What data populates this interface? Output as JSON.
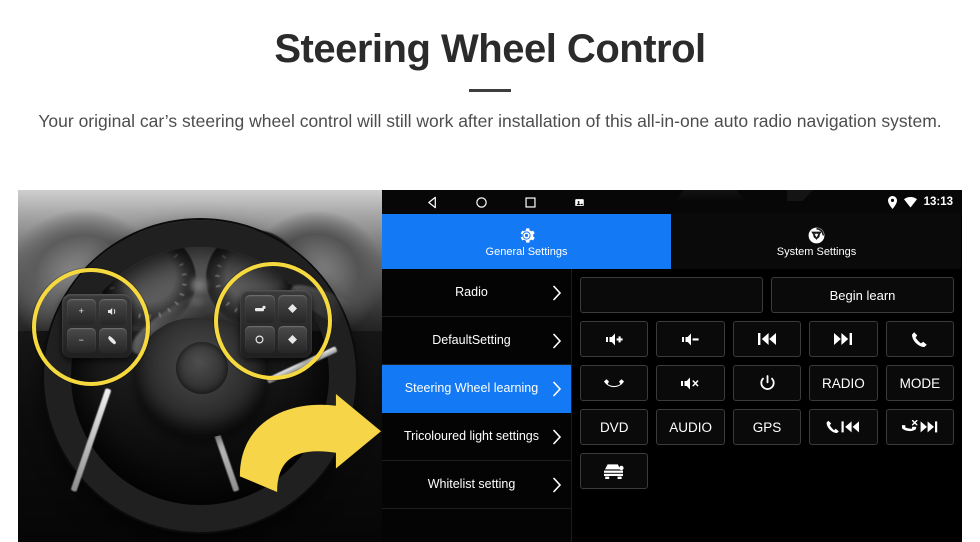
{
  "header": {
    "title": "Steering Wheel Control",
    "subtitle": "Your original car’s steering wheel control will still work after installation of this all-in-one auto radio navigation system."
  },
  "colors": {
    "accent_blue": "#1479F5",
    "highlight_yellow": "#F5D93F",
    "arrow_yellow": "#F7D548",
    "panel_black": "#000000",
    "title_text": "#2B2B2B"
  },
  "photo": {
    "alt": "Grayscale close-up of a car steering wheel with two yellow circles highlighting the left and right control button clusters, and a yellow arrow pointing right toward the radio UI",
    "left_cluster_keys": [
      "+",
      "−",
      "voice",
      "call"
    ],
    "right_cluster_keys": [
      "media",
      "up",
      "mode",
      "down"
    ]
  },
  "ui": {
    "statusbar": {
      "nav_icons": [
        "back-icon",
        "home-icon",
        "recents-icon",
        "screenshot-icon"
      ],
      "status_icons": [
        "location-pin-icon",
        "wifi-icon"
      ],
      "time": "13:13"
    },
    "tabs": [
      {
        "label": "General Settings",
        "icon": "gear-icon",
        "active": true
      },
      {
        "label": "System Settings",
        "icon": "system-chip-icon",
        "active": false
      }
    ],
    "menu": [
      {
        "label": "Radio",
        "active": false
      },
      {
        "label": "DefaultSetting",
        "active": false
      },
      {
        "label": "Steering Wheel learning",
        "active": true
      },
      {
        "label": "Tricoloured light settings",
        "active": false
      },
      {
        "label": "Whitelist setting",
        "active": false
      }
    ],
    "panel": {
      "learn_display_value": "",
      "begin_learn_label": "Begin learn",
      "buttons": [
        {
          "label": "",
          "icon": "volume-up-icon"
        },
        {
          "label": "",
          "icon": "volume-down-icon"
        },
        {
          "label": "",
          "icon": "previous-track-icon"
        },
        {
          "label": "",
          "icon": "next-track-icon"
        },
        {
          "label": "",
          "icon": "call-answer-icon"
        },
        {
          "label": "",
          "icon": "call-hangup-icon"
        },
        {
          "label": "",
          "icon": "volume-mute-icon"
        },
        {
          "label": "",
          "icon": "power-icon"
        },
        {
          "label": "RADIO",
          "icon": ""
        },
        {
          "label": "MODE",
          "icon": ""
        },
        {
          "label": "DVD",
          "icon": ""
        },
        {
          "label": "AUDIO",
          "icon": ""
        },
        {
          "label": "GPS",
          "icon": ""
        },
        {
          "label": "",
          "icon": "call-previous-icon"
        },
        {
          "label": "",
          "icon": "hangup-next-icon"
        },
        {
          "label": "",
          "icon": "car-front-icon"
        }
      ]
    }
  }
}
